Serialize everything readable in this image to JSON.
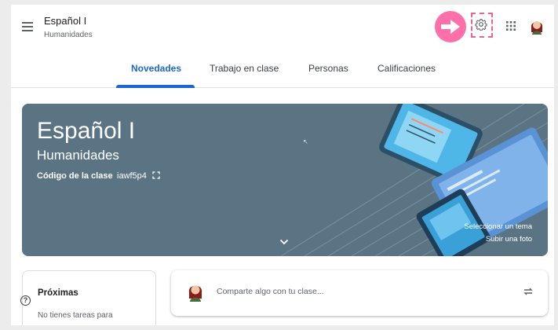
{
  "header": {
    "course_title": "Español I",
    "course_section": "Humanidades",
    "icons": [
      "menu-icon",
      "arrow-right-icon",
      "gear-icon",
      "apps-icon",
      "avatar"
    ]
  },
  "tabs": [
    {
      "label": "Novedades",
      "active": true
    },
    {
      "label": "Trabajo en clase",
      "active": false
    },
    {
      "label": "Personas",
      "active": false
    },
    {
      "label": "Calificaciones",
      "active": false
    }
  ],
  "banner": {
    "title": "Español I",
    "subtitle": "Humanidades",
    "code_label": "Código de la clase",
    "code_value": "iawf5p4",
    "select_theme": "Seleccionar un tema",
    "upload_photo": "Subir una foto",
    "background_color": "#5b7483"
  },
  "upcoming": {
    "title": "Próximas",
    "text": "No tienes tareas para"
  },
  "stream": {
    "placeholder": "Comparte algo con tu clase..."
  },
  "colors": {
    "accent": "#1967d2",
    "highlight": "#ff6fa9"
  }
}
